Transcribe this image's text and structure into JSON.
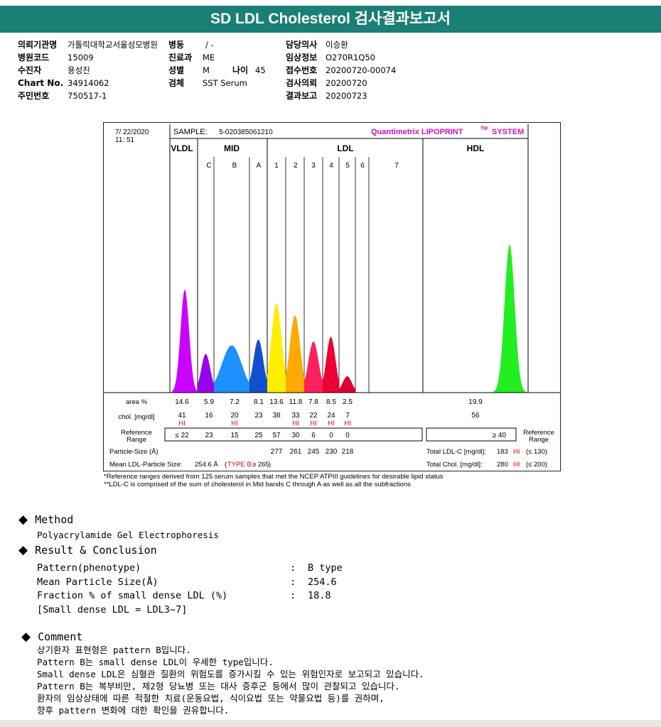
{
  "header": {
    "title": "SD LDL Cholesterol 검사결과보고서"
  },
  "patient": {
    "col1": [
      {
        "key": "의뢰기관명",
        "value": "가톨릭대학교서울성모병원"
      },
      {
        "key": "병원코드",
        "value": "15009"
      },
      {
        "key": "수진자",
        "value": "용성진"
      },
      {
        "key": "Chart No.",
        "value": "34914062"
      },
      {
        "key": "주민번호",
        "value": "750517-1"
      }
    ],
    "ward": {
      "key": "병동",
      "value": "/ -"
    },
    "dept": {
      "key": "진료과",
      "value": "ME"
    },
    "sex": {
      "key": "성별",
      "value": "M"
    },
    "age": {
      "key": "나이",
      "value": "45"
    },
    "specimen": {
      "key": "검체",
      "value": "SST Serum"
    },
    "col3": [
      {
        "key": "담당의사",
        "value": "이승환"
      },
      {
        "key": "임상정보",
        "value": "O270R1Q50"
      },
      {
        "key": "접수번호",
        "value": "20200720-00074"
      },
      {
        "key": "검사의뢰",
        "value": "20200720"
      },
      {
        "key": "결과보고",
        "value": "20200723"
      }
    ]
  },
  "report": {
    "date": "7/ 22/2020",
    "time": "11: 51",
    "sample_label": "SAMPLE:",
    "sample_id": "5-020385061210",
    "brand": "Quantimetrix LIPOPRINT",
    "brand_tm": "TM",
    "brand_tail": "SYSTEM",
    "groups": [
      "VLDL",
      "MID",
      "LDL",
      "HDL"
    ],
    "bands": [
      "C",
      "B",
      "A",
      "1",
      "2",
      "3",
      "4",
      "5",
      "6",
      "7"
    ],
    "row_labels": {
      "area": "area %",
      "chol": "chol. [mg/dl]",
      "ref1": "Reference",
      "ref2": "Range",
      "size": "Particle-Size (Å)"
    },
    "area": [
      "14.6",
      "5.9",
      "7.2",
      "8.1",
      "13.6",
      "11.8",
      "7.8",
      "8.5",
      "2.5"
    ],
    "area_hdl": "19.9",
    "chol": [
      "41",
      "16",
      "20",
      "23",
      "38",
      "33",
      "22",
      "24",
      "7"
    ],
    "chol_hdl": "56",
    "hi_flag": "HI",
    "ref_range": [
      "≤ 22",
      "23",
      "15",
      "25",
      "57",
      "30",
      "6",
      "0",
      "0"
    ],
    "ref_hdl": "≥ 40",
    "particle_size": [
      "277",
      "261",
      "245",
      "230",
      "218"
    ],
    "mean_size_label": "Mean LDL-Particle Size:",
    "mean_size_value": "254.6 Å",
    "mean_size_type": "TYPE B",
    "mean_size_limit": "≥ 265",
    "total_ldl_label": "Total LDL-C [mg/dl]:",
    "total_ldl_value": "183",
    "total_ldl_limit": "(≤ 130)",
    "total_chol_label": "Total Chol. [mg/dl]:",
    "total_chol_value": "280",
    "total_chol_limit": "(≤ 200)"
  },
  "chart_data": {
    "type": "area",
    "x": [
      "VLDL",
      "C",
      "B",
      "A",
      "1",
      "2",
      "3",
      "4",
      "5",
      "6",
      "7",
      "HDL"
    ],
    "series": [
      {
        "values": [
          14.6,
          5.9,
          7.2,
          8.1,
          13.6,
          11.8,
          7.8,
          8.5,
          2.5,
          0,
          0,
          19.9
        ]
      }
    ],
    "colors": [
      "#cc00ff",
      "#9900ee",
      "#1e90ff",
      "#1050d0",
      "#ffee00",
      "#ffaa00",
      "#ff2060",
      "#ee0033",
      "#e00030",
      "#c00020",
      "#c00020",
      "#22ee22"
    ]
  },
  "footnotes": [
    "*Reference ranges derived from 125 serum samples that met the NCEP ATPIII guidelines for desirable lipid status",
    "**LDL-C is comprised of the sum of cholesterol in Mid bands C through A as well as all the subfractions"
  ],
  "method": {
    "heading": "Method",
    "text": "Polyacrylamide Gel Electrophoresis"
  },
  "result": {
    "heading": "Result & Conclusion",
    "rows": [
      {
        "label": "Pattern(phenotype)",
        "value": "B type"
      },
      {
        "label": "Mean Particle Size(Å)",
        "value": "254.6"
      },
      {
        "label": "Fraction % of small dense LDL (%)",
        "value": "18.8"
      }
    ],
    "separator": ":",
    "note": "[Small dense LDL = LDL3~7]"
  },
  "comment": {
    "heading": "Comment",
    "lines": [
      "상기환자 표현형은 pattern B입니다.",
      "Pattern B는 small dense LDL이 우세한 type입니다.",
      "Small dense LDL은 심혈관 질환의 위험도를 증가시킬 수 있는 위험인자로 보고되고 있습니다.",
      "Pattern B는 복부비만, 제2형 당뇨병 또는 대사 증후군 등에서 많이 관찰되고 있습니다.",
      "환자의 임상상태에 따른 적절한 치료(운동요법, 식이요법 또는 약물요법 등)를 권하며,",
      "향후 pattern 변화에 대한 확인을 권유합니다."
    ]
  }
}
